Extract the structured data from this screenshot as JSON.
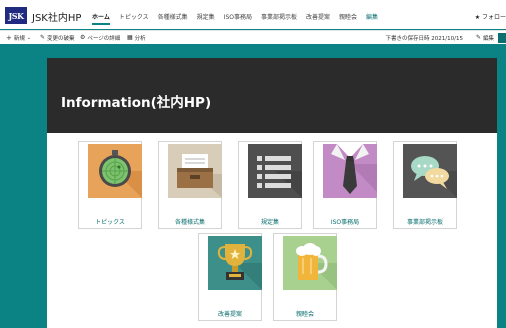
{
  "suite": {
    "logo_text": "JSK",
    "site_title": "JSK社内HP",
    "nav": [
      "ホーム",
      "トピックス",
      "各種様式集",
      "規定集",
      "ISO事務局",
      "事業部掲示板",
      "改善提案",
      "親睦会",
      "編集"
    ],
    "follow": "★ フォロー"
  },
  "command_bar": {
    "new": "新規",
    "discard": "変更の破棄",
    "page_details": "ページの詳細",
    "analytics": "分析",
    "save_status": "下書きの保存日時 2021/10/15",
    "edit": "編集"
  },
  "hero": {
    "title": "Information(社内HP)"
  },
  "tiles": [
    {
      "label": "トピックス",
      "icon": "radar-icon",
      "bg": "#e8a35a"
    },
    {
      "label": "各種様式集",
      "icon": "file-drawer-icon",
      "bg": "#d8cdb9"
    },
    {
      "label": "規定集",
      "icon": "list-icon",
      "bg": "#4f4f4f"
    },
    {
      "label": "ISO事務局",
      "icon": "necktie-icon",
      "bg": "#c38bc6"
    },
    {
      "label": "事業部掲示板",
      "icon": "chat-bubbles-icon",
      "bg": "#545454"
    },
    {
      "label": "改善提案",
      "icon": "trophy-icon",
      "bg": "#3d8f8a"
    },
    {
      "label": "親睦会",
      "icon": "beer-mug-icon",
      "bg": "#a8d18f"
    }
  ],
  "colors": {
    "accent": "#0b8384",
    "hero": "#2b2b2b",
    "link": "#0b6f70"
  }
}
